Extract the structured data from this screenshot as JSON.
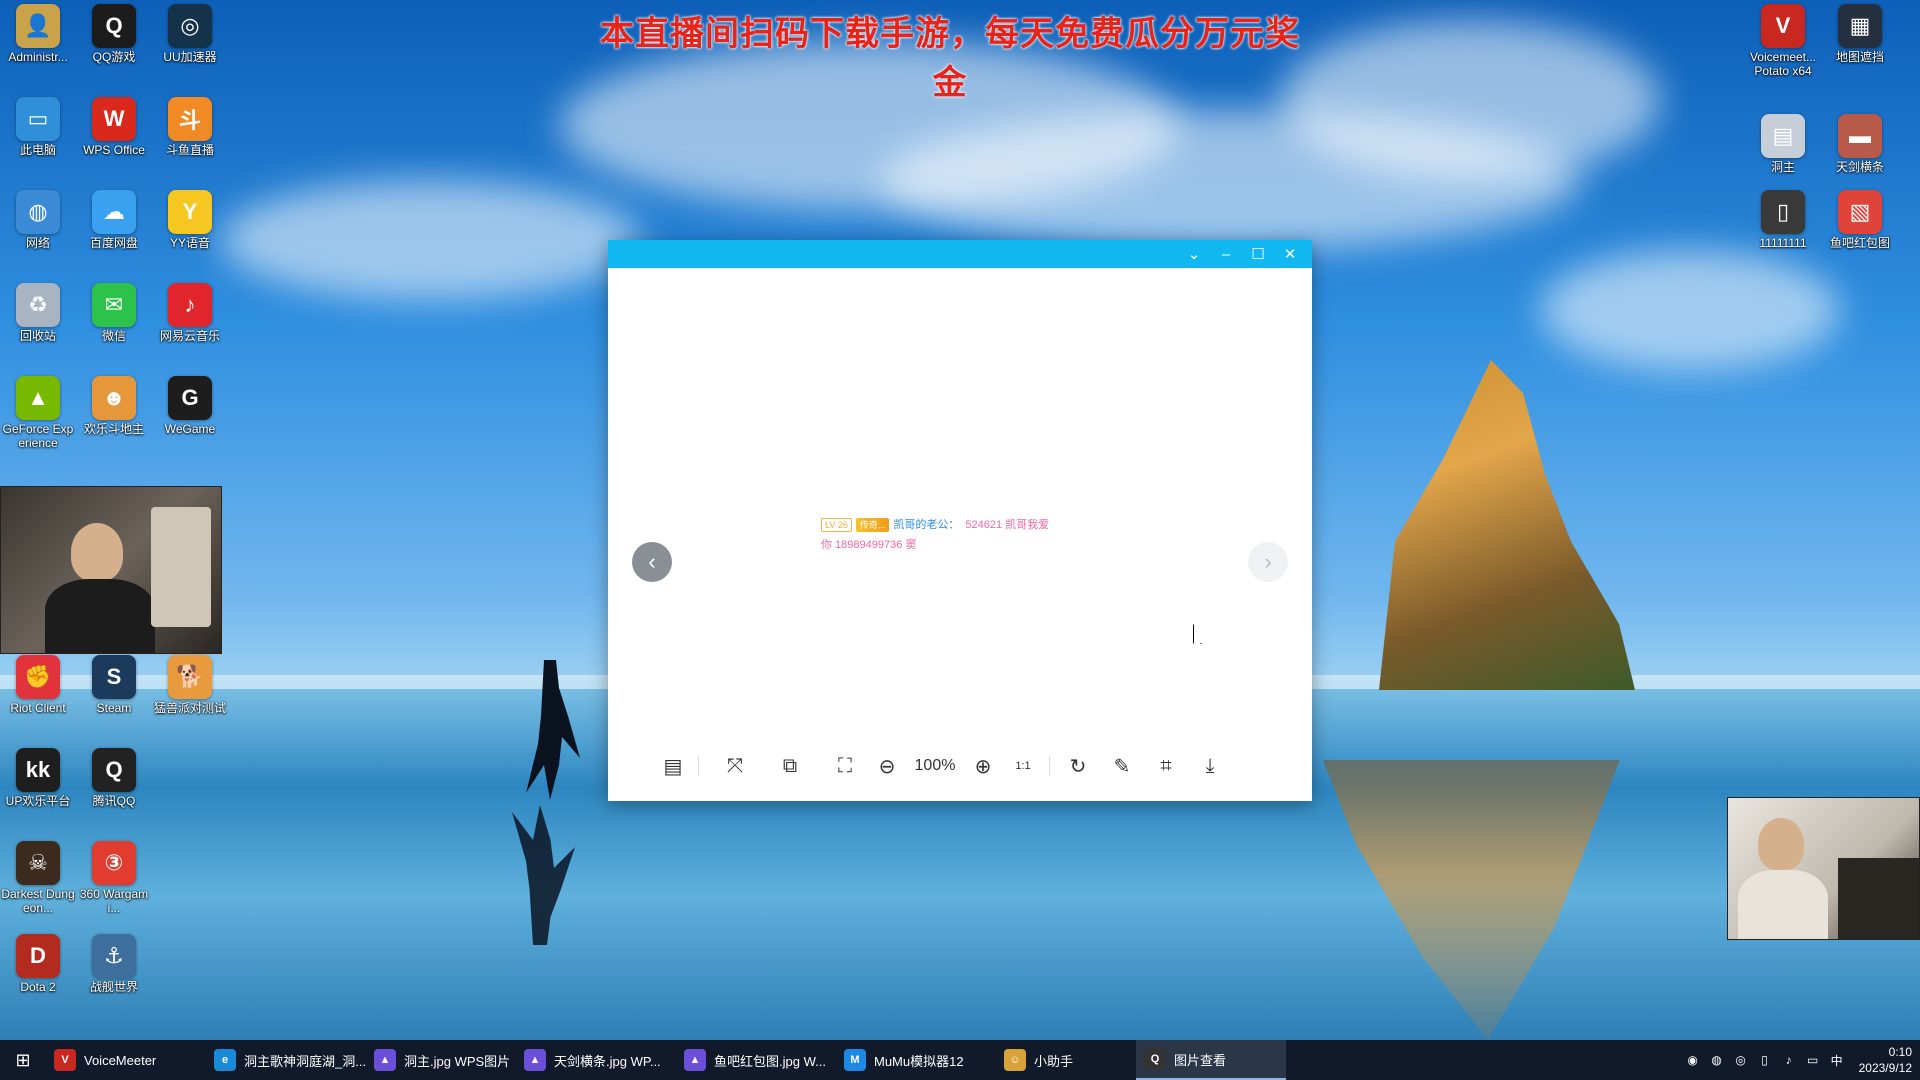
{
  "banner": {
    "text": "本直播间扫码下载手游，每天免费瓜分万元奖金"
  },
  "desktop_icons": [
    {
      "label": "Administr...",
      "glyph": "👤",
      "color": "#c9a24a"
    },
    {
      "label": "QQ游戏",
      "glyph": "Q",
      "color": "#1c1c1c"
    },
    {
      "label": "UU加速器",
      "glyph": "◎",
      "color": "#15324b"
    },
    {
      "label": "此电脑",
      "glyph": "▭",
      "color": "#2f8fd8"
    },
    {
      "label": "WPS Office",
      "glyph": "W",
      "color": "#d9291c"
    },
    {
      "label": "斗鱼直播",
      "glyph": "斗",
      "color": "#f08a24"
    },
    {
      "label": "网络",
      "glyph": "◍",
      "color": "#3a8ad6"
    },
    {
      "label": "百度网盘",
      "glyph": "☁",
      "color": "#3aa0f0"
    },
    {
      "label": "YY语音",
      "glyph": "Y",
      "color": "#f6c621"
    },
    {
      "label": "回收站",
      "glyph": "♻",
      "color": "#a8b4c2"
    },
    {
      "label": "微信",
      "glyph": "✉",
      "color": "#2dc24a"
    },
    {
      "label": "网易云音乐",
      "glyph": "♪",
      "color": "#e0262c"
    },
    {
      "label": "GeForce Experience",
      "glyph": "▲",
      "color": "#76b900"
    },
    {
      "label": "欢乐斗地主",
      "glyph": "☻",
      "color": "#e6973a"
    },
    {
      "label": "WeGame",
      "glyph": "G",
      "color": "#1d1d1d"
    },
    {
      "label": "Riot Client",
      "glyph": "✊",
      "color": "#e2333d"
    },
    {
      "label": "Steam",
      "glyph": "S",
      "color": "#1b3a5c"
    },
    {
      "label": "猛兽派对测试",
      "glyph": "🐕",
      "color": "#e99a3c"
    },
    {
      "label": "UP欢乐平台",
      "glyph": "kk",
      "color": "#1e1e1e"
    },
    {
      "label": "腾讯QQ",
      "glyph": "Q",
      "color": "#222"
    },
    {
      "label": "Darkest Dungeon...",
      "glyph": "☠",
      "color": "#3b2a1d"
    },
    {
      "label": "360 Wargami...",
      "glyph": "③",
      "color": "#e23b30"
    },
    {
      "label": "Dota 2",
      "glyph": "D",
      "color": "#b32a1f"
    },
    {
      "label": "战舰世界",
      "glyph": "⚓",
      "color": "#3d6e9c"
    },
    {
      "label": "Voicemeet... Potato x64",
      "glyph": "V",
      "color": "#c8281f"
    },
    {
      "label": "地图遮挡",
      "glyph": "▦",
      "color": "#24303f"
    },
    {
      "label": "洞主",
      "glyph": "▤",
      "color": "#c6cfd8"
    },
    {
      "label": "天剑横条",
      "glyph": "▬",
      "color": "#b85a4a"
    },
    {
      "label": "11111111",
      "glyph": "▯",
      "color": "#3a3a3a"
    },
    {
      "label": "鱼吧红包图",
      "glyph": "▧",
      "color": "#e0433a"
    }
  ],
  "viewer": {
    "titlebar_buttons": [
      "⌄",
      "–",
      "☐",
      "✕"
    ],
    "chat": {
      "level": "LV 26",
      "fan_badge": "传奇...",
      "user": "凯哥的老公：",
      "message": "524621 凯哥我爱",
      "line2": "你 18989499736 窦"
    },
    "prev_arrow": "‹",
    "next_arrow": "›",
    "toolbar": {
      "zoom": "100%",
      "icons": {
        "thumbnails": "▤",
        "fit": "⤧",
        "compare": "⧉",
        "fullscreen": "⛶",
        "zoom_out": "⊖",
        "zoom_in": "⊕",
        "actual_size": "1:1",
        "rotate": "↻",
        "edit": "✎",
        "crop": "⌗",
        "download": "⤓"
      }
    }
  },
  "taskbar": {
    "start_icon": "⊞",
    "items": [
      {
        "label": "VoiceMeeter",
        "icon": "V",
        "color": "#c8281f",
        "active": false
      },
      {
        "label": "洞主歌神洞庭湖_洞...",
        "icon": "e",
        "color": "#1b8ad6",
        "active": false
      },
      {
        "label": "洞主.jpg  WPS图片",
        "icon": "▲",
        "color": "#6b4fd8",
        "active": false
      },
      {
        "label": "天剑横条.jpg  WP...",
        "icon": "▲",
        "color": "#6b4fd8",
        "active": false
      },
      {
        "label": "鱼吧红包图.jpg  W...",
        "icon": "▲",
        "color": "#6b4fd8",
        "active": false
      },
      {
        "label": "MuMu模拟器12",
        "icon": "M",
        "color": "#1e88e5",
        "active": false
      },
      {
        "label": "小助手",
        "icon": "☺",
        "color": "#d8a23a",
        "active": false
      },
      {
        "label": "图片查看",
        "icon": "Q",
        "color": "#333",
        "active": true
      }
    ],
    "tray_icons": [
      "◉",
      "◍",
      "◎",
      "▯",
      "♪",
      "▭",
      "中"
    ],
    "time": "0:10",
    "date": "2023/9/12"
  }
}
